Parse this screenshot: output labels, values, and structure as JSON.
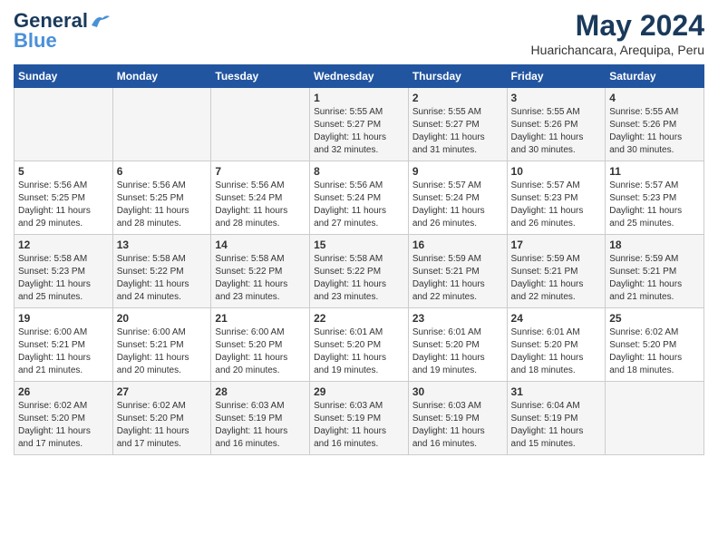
{
  "header": {
    "logo_line1": "General",
    "logo_line2": "Blue",
    "main_title": "May 2024",
    "subtitle": "Huarichancara, Arequipa, Peru"
  },
  "days_of_week": [
    "Sunday",
    "Monday",
    "Tuesday",
    "Wednesday",
    "Thursday",
    "Friday",
    "Saturday"
  ],
  "weeks": [
    [
      {
        "day": "",
        "content": ""
      },
      {
        "day": "",
        "content": ""
      },
      {
        "day": "",
        "content": ""
      },
      {
        "day": "1",
        "content": "Sunrise: 5:55 AM\nSunset: 5:27 PM\nDaylight: 11 hours\nand 32 minutes."
      },
      {
        "day": "2",
        "content": "Sunrise: 5:55 AM\nSunset: 5:27 PM\nDaylight: 11 hours\nand 31 minutes."
      },
      {
        "day": "3",
        "content": "Sunrise: 5:55 AM\nSunset: 5:26 PM\nDaylight: 11 hours\nand 30 minutes."
      },
      {
        "day": "4",
        "content": "Sunrise: 5:55 AM\nSunset: 5:26 PM\nDaylight: 11 hours\nand 30 minutes."
      }
    ],
    [
      {
        "day": "5",
        "content": "Sunrise: 5:56 AM\nSunset: 5:25 PM\nDaylight: 11 hours\nand 29 minutes."
      },
      {
        "day": "6",
        "content": "Sunrise: 5:56 AM\nSunset: 5:25 PM\nDaylight: 11 hours\nand 28 minutes."
      },
      {
        "day": "7",
        "content": "Sunrise: 5:56 AM\nSunset: 5:24 PM\nDaylight: 11 hours\nand 28 minutes."
      },
      {
        "day": "8",
        "content": "Sunrise: 5:56 AM\nSunset: 5:24 PM\nDaylight: 11 hours\nand 27 minutes."
      },
      {
        "day": "9",
        "content": "Sunrise: 5:57 AM\nSunset: 5:24 PM\nDaylight: 11 hours\nand 26 minutes."
      },
      {
        "day": "10",
        "content": "Sunrise: 5:57 AM\nSunset: 5:23 PM\nDaylight: 11 hours\nand 26 minutes."
      },
      {
        "day": "11",
        "content": "Sunrise: 5:57 AM\nSunset: 5:23 PM\nDaylight: 11 hours\nand 25 minutes."
      }
    ],
    [
      {
        "day": "12",
        "content": "Sunrise: 5:58 AM\nSunset: 5:23 PM\nDaylight: 11 hours\nand 25 minutes."
      },
      {
        "day": "13",
        "content": "Sunrise: 5:58 AM\nSunset: 5:22 PM\nDaylight: 11 hours\nand 24 minutes."
      },
      {
        "day": "14",
        "content": "Sunrise: 5:58 AM\nSunset: 5:22 PM\nDaylight: 11 hours\nand 23 minutes."
      },
      {
        "day": "15",
        "content": "Sunrise: 5:58 AM\nSunset: 5:22 PM\nDaylight: 11 hours\nand 23 minutes."
      },
      {
        "day": "16",
        "content": "Sunrise: 5:59 AM\nSunset: 5:21 PM\nDaylight: 11 hours\nand 22 minutes."
      },
      {
        "day": "17",
        "content": "Sunrise: 5:59 AM\nSunset: 5:21 PM\nDaylight: 11 hours\nand 22 minutes."
      },
      {
        "day": "18",
        "content": "Sunrise: 5:59 AM\nSunset: 5:21 PM\nDaylight: 11 hours\nand 21 minutes."
      }
    ],
    [
      {
        "day": "19",
        "content": "Sunrise: 6:00 AM\nSunset: 5:21 PM\nDaylight: 11 hours\nand 21 minutes."
      },
      {
        "day": "20",
        "content": "Sunrise: 6:00 AM\nSunset: 5:21 PM\nDaylight: 11 hours\nand 20 minutes."
      },
      {
        "day": "21",
        "content": "Sunrise: 6:00 AM\nSunset: 5:20 PM\nDaylight: 11 hours\nand 20 minutes."
      },
      {
        "day": "22",
        "content": "Sunrise: 6:01 AM\nSunset: 5:20 PM\nDaylight: 11 hours\nand 19 minutes."
      },
      {
        "day": "23",
        "content": "Sunrise: 6:01 AM\nSunset: 5:20 PM\nDaylight: 11 hours\nand 19 minutes."
      },
      {
        "day": "24",
        "content": "Sunrise: 6:01 AM\nSunset: 5:20 PM\nDaylight: 11 hours\nand 18 minutes."
      },
      {
        "day": "25",
        "content": "Sunrise: 6:02 AM\nSunset: 5:20 PM\nDaylight: 11 hours\nand 18 minutes."
      }
    ],
    [
      {
        "day": "26",
        "content": "Sunrise: 6:02 AM\nSunset: 5:20 PM\nDaylight: 11 hours\nand 17 minutes."
      },
      {
        "day": "27",
        "content": "Sunrise: 6:02 AM\nSunset: 5:20 PM\nDaylight: 11 hours\nand 17 minutes."
      },
      {
        "day": "28",
        "content": "Sunrise: 6:03 AM\nSunset: 5:19 PM\nDaylight: 11 hours\nand 16 minutes."
      },
      {
        "day": "29",
        "content": "Sunrise: 6:03 AM\nSunset: 5:19 PM\nDaylight: 11 hours\nand 16 minutes."
      },
      {
        "day": "30",
        "content": "Sunrise: 6:03 AM\nSunset: 5:19 PM\nDaylight: 11 hours\nand 16 minutes."
      },
      {
        "day": "31",
        "content": "Sunrise: 6:04 AM\nSunset: 5:19 PM\nDaylight: 11 hours\nand 15 minutes."
      },
      {
        "day": "",
        "content": ""
      }
    ]
  ]
}
